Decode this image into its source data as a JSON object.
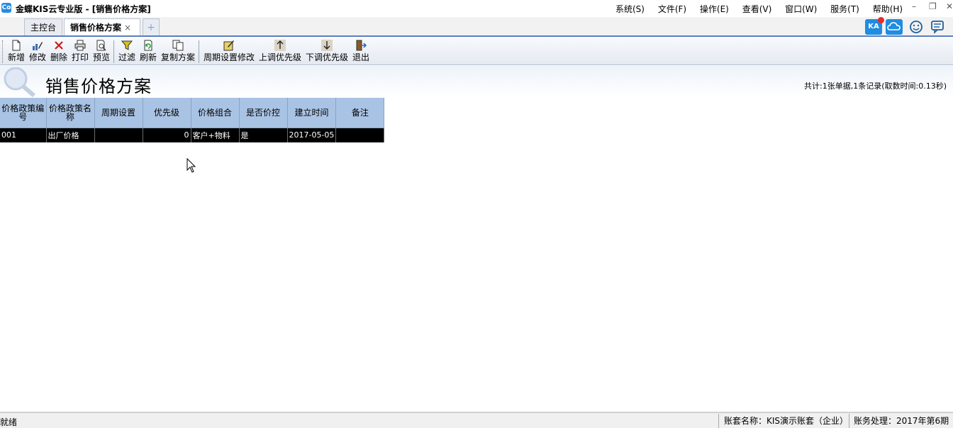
{
  "window": {
    "title": "金蝶KIS云专业版 - [销售价格方案]",
    "app_icon_text": "Co"
  },
  "menu": [
    "系统(S)",
    "文件(F)",
    "操作(E)",
    "查看(V)",
    "窗口(W)",
    "服务(T)",
    "帮助(H)"
  ],
  "tabs": {
    "main": "主控台",
    "active": "销售价格方案",
    "close_glyph": "×",
    "add_glyph": "+"
  },
  "top_right_icons": [
    "kis-assistant-icon",
    "cloud-icon",
    "smiley-icon",
    "message-icon"
  ],
  "top_right_kis_text": "KA",
  "toolbar": {
    "new": "新增",
    "modify": "修改",
    "delete": "删除",
    "print": "打印",
    "preview": "预览",
    "filter": "过滤",
    "refresh": "刷新",
    "copy_plan": "复制方案",
    "period_setting_modify": "周期设置修改",
    "priority_up": "上调优先级",
    "priority_down": "下调优先级",
    "exit": "退出"
  },
  "header": {
    "title": "销售价格方案",
    "summary": "共计:1张单据,1条记录(取数时间:0.13秒)"
  },
  "grid": {
    "columns": [
      "价格政策编号",
      "价格政策名称",
      "周期设置",
      "优先级",
      "价格组合",
      "是否价控",
      "建立时间",
      "备注"
    ],
    "rows": [
      [
        "001",
        "出厂价格",
        "",
        "0",
        "客户+物料",
        "是",
        "2017-05-05",
        ""
      ]
    ]
  },
  "status": {
    "ready": "就绪",
    "account": "账套名称：KIS演示账套（企业）",
    "period": "账务处理：2017年第6期"
  },
  "colors": {
    "accent_blue": "#1f8de0",
    "grid_header": "#a9c3e4",
    "selected_row": "#000000"
  }
}
